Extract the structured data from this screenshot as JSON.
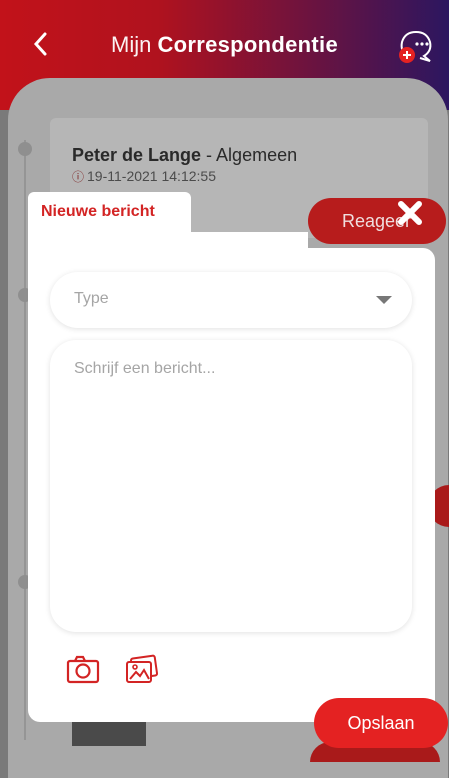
{
  "header": {
    "title_light": "Mijn ",
    "title_bold": "Correspondentie",
    "back_icon": "chevron-left-icon",
    "action_icon": "new-conversation-icon"
  },
  "background": {
    "message": {
      "sender": "Peter de Lange",
      "category": " - Algemeen",
      "date": "19-11-2021 14:12:55"
    },
    "reply_label": "Reageer"
  },
  "modal": {
    "tab_label": "Nieuwe bericht",
    "type_placeholder": "Type",
    "message_placeholder": "Schrijf een bericht...",
    "save_label": "Opslaan"
  },
  "colors": {
    "brand_red": "#e42222",
    "header_gradient_start": "#c2121a",
    "header_gradient_end": "#2c1660"
  }
}
